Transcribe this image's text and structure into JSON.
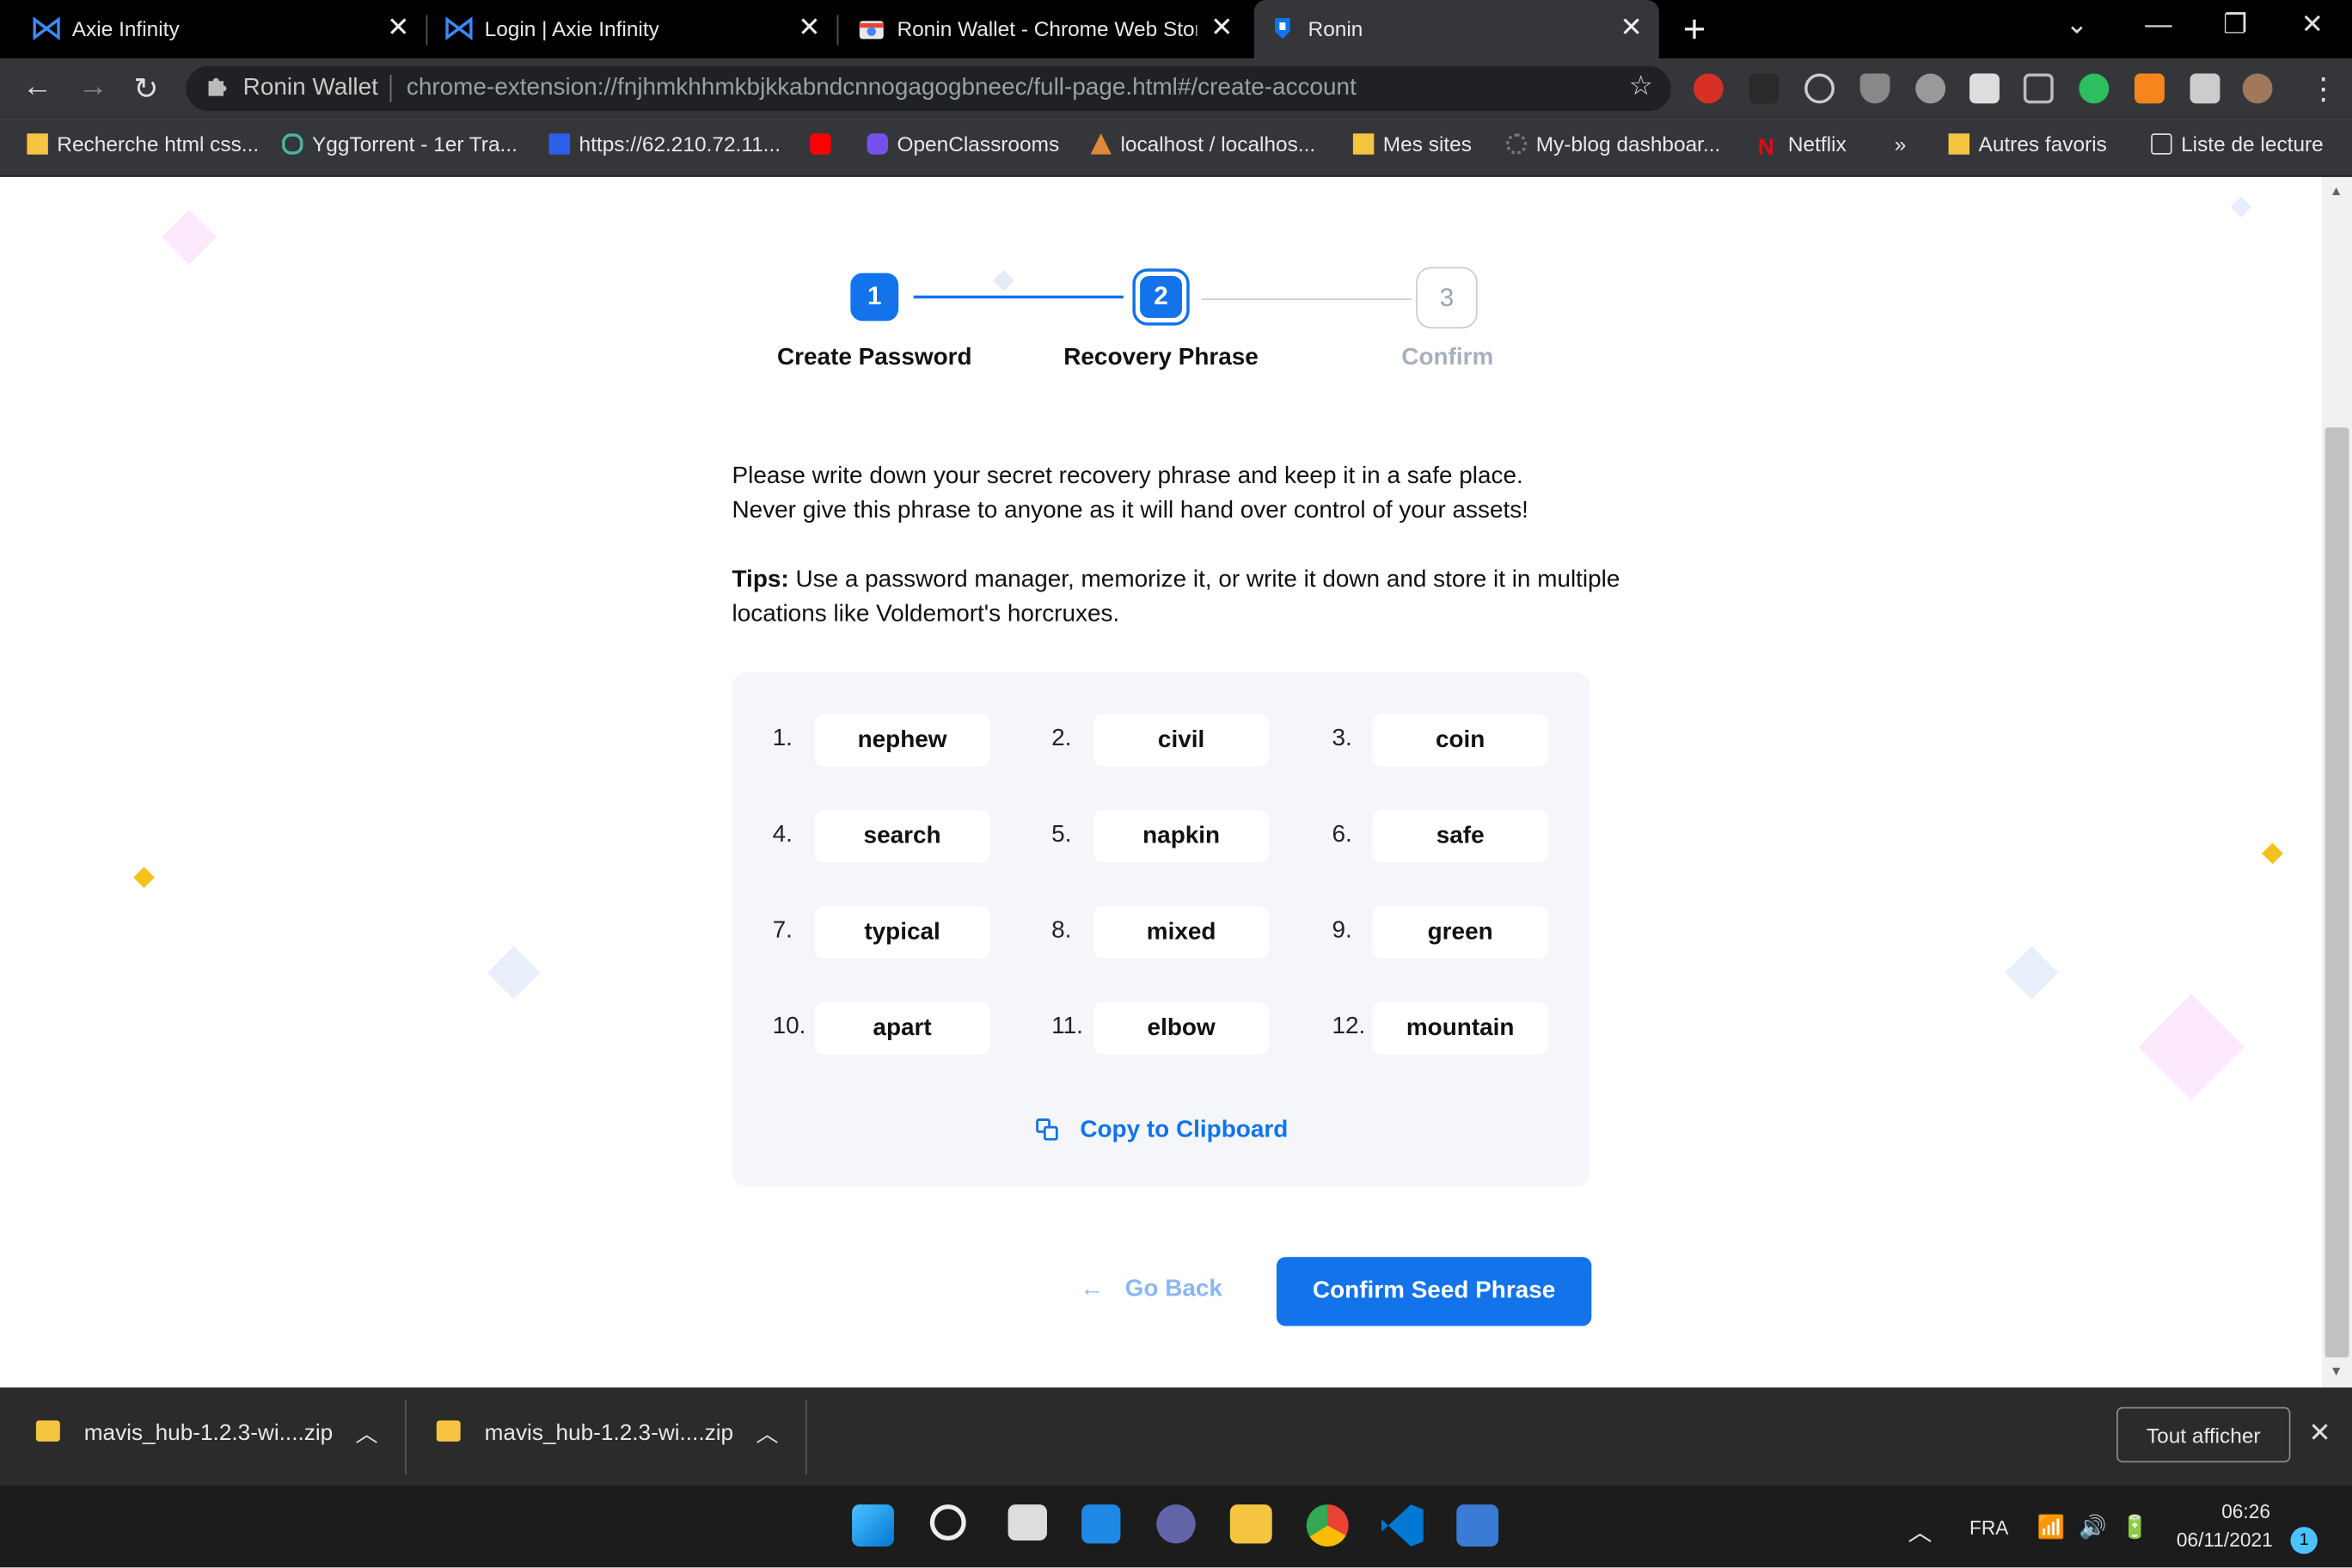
{
  "browser": {
    "tabs": [
      {
        "title": "Axie Infinity",
        "active": false
      },
      {
        "title": "Login | Axie Infinity",
        "active": false
      },
      {
        "title": "Ronin Wallet - Chrome Web Store",
        "active": false
      },
      {
        "title": "Ronin",
        "active": true
      }
    ],
    "omnibox": {
      "site_name": "Ronin Wallet",
      "url": "chrome-extension://fnjhmkhhmkbjkkabndcnnogagogbneec/full-page.html#/create-account"
    },
    "bookmarks": [
      "Recherche html css...",
      "YggTorrent - 1er Tra...",
      "https://62.210.72.11...",
      "",
      "OpenClassrooms",
      "localhost / localhos...",
      "Mes sites",
      "My-blog dashboar...",
      "Netflix",
      "»",
      "Autres favoris",
      "Liste de lecture"
    ]
  },
  "stepper": {
    "steps": [
      {
        "number": "1",
        "label": "Create Password",
        "state": "done"
      },
      {
        "number": "2",
        "label": "Recovery Phrase",
        "state": "current"
      },
      {
        "number": "3",
        "label": "Confirm",
        "state": "upcoming"
      }
    ]
  },
  "content": {
    "intro_line1": "Please write down your secret recovery phrase and keep it in a safe place.",
    "intro_line2": "Never give this phrase to anyone as it will hand over control of your assets!",
    "tips_label": "Tips:",
    "tips_text": " Use a password manager, memorize it, or write it down and store it in multiple locations like Voldemort's horcruxes."
  },
  "phrase": {
    "words": [
      {
        "num": "1.",
        "word": "nephew"
      },
      {
        "num": "2.",
        "word": "civil"
      },
      {
        "num": "3.",
        "word": "coin"
      },
      {
        "num": "4.",
        "word": "search"
      },
      {
        "num": "5.",
        "word": "napkin"
      },
      {
        "num": "6.",
        "word": "safe"
      },
      {
        "num": "7.",
        "word": "typical"
      },
      {
        "num": "8.",
        "word": "mixed"
      },
      {
        "num": "9.",
        "word": "green"
      },
      {
        "num": "10.",
        "word": "apart"
      },
      {
        "num": "11.",
        "word": "elbow"
      },
      {
        "num": "12.",
        "word": "mountain"
      }
    ],
    "copy_label": "Copy to Clipboard"
  },
  "actions": {
    "go_back": "Go Back",
    "confirm": "Confirm Seed Phrase"
  },
  "downloads": {
    "items": [
      "mavis_hub-1.2.3-wi....zip",
      "mavis_hub-1.2.3-wi....zip"
    ],
    "show_all": "Tout afficher"
  },
  "taskbar": {
    "language": "FRA",
    "time": "06:26",
    "date": "06/11/2021",
    "notifications": "1"
  },
  "colors": {
    "accent": "#1273ea",
    "accent_light": "#8cb7f0",
    "phrase_bg": "#f4f6fa"
  }
}
